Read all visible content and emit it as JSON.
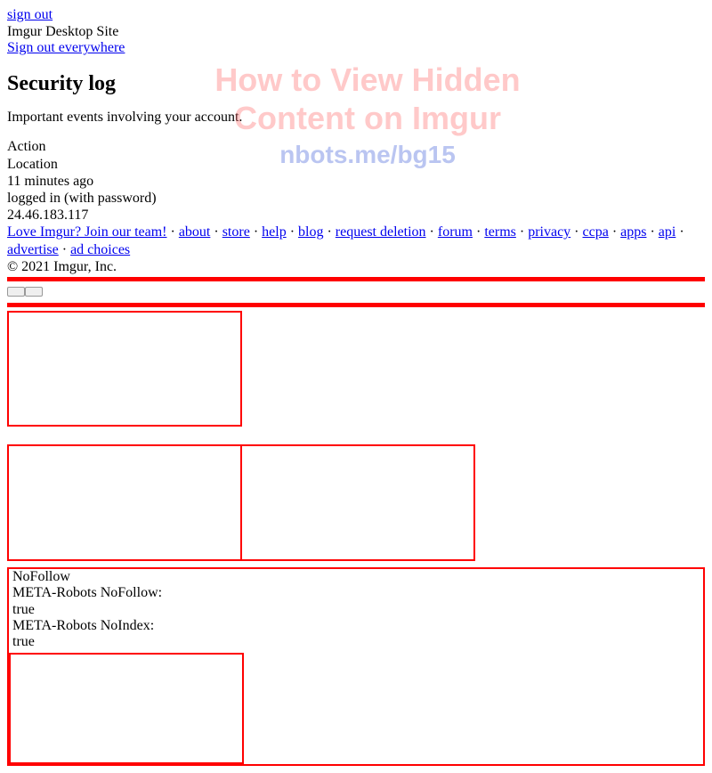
{
  "topLinks": {
    "signOut": "sign out",
    "desktopSite": "Imgur Desktop Site",
    "signOutEverywhere": "Sign out everywhere"
  },
  "heading": "Security log",
  "subtitle": "Important events involving your account.",
  "log": {
    "action": "Action",
    "location": "Location",
    "time": "11 minutes ago",
    "event": "logged in (with password)",
    "ip": "24.46.183.117"
  },
  "footer": {
    "loveImgur": "Love Imgur? Join our team!",
    "about": "about",
    "store": "store",
    "help": "help",
    "blog": "blog",
    "requestDeletion": "request deletion",
    "forum": "forum",
    "terms": "terms",
    "privacy": "privacy",
    "ccpa": "ccpa",
    "apps": "apps",
    "api": "api",
    "advertise": "advertise",
    "adChoices": "ad choices",
    "copyright": "© 2021 Imgur, Inc."
  },
  "meta": {
    "nofollow": "NoFollow",
    "robotsNofollowLabel": "META-Robots NoFollow:",
    "robotsNofollowValue": "true",
    "robotsNoindexLabel": "META-Robots NoIndex:",
    "robotsNoindexValue": "true"
  },
  "watermark": {
    "title": "How to View Hidden Content on Imgur",
    "url": "nbots.me/bg15"
  }
}
